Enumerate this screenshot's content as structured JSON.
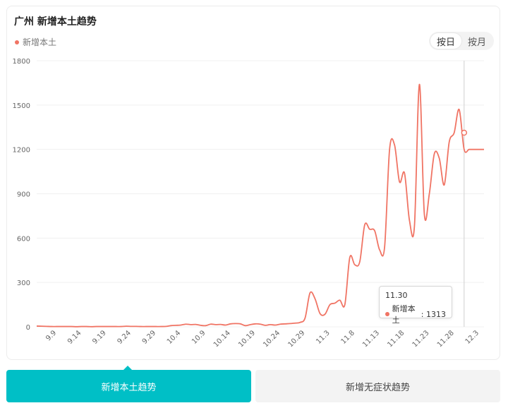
{
  "header": {
    "title": "广州 新增本土趋势"
  },
  "legend": {
    "label": "新增本土",
    "color": "#f07464"
  },
  "toggle": {
    "day_label": "按日",
    "month_label": "按月",
    "active": "day"
  },
  "tooltip": {
    "date": "11.30",
    "series_label": "新增本土",
    "value": "1313"
  },
  "tabs": [
    {
      "label": "新增本土趋势",
      "active": true
    },
    {
      "label": "新增无症状趋势",
      "active": false
    }
  ],
  "chart_data": {
    "type": "line",
    "title": "广州 新增本土趋势",
    "xlabel": "",
    "ylabel": "",
    "ylim": [
      0,
      1800
    ],
    "yticks": [
      0,
      300,
      600,
      900,
      1200,
      1500,
      1800
    ],
    "grid": true,
    "legend_position": "top-left",
    "line_color": "#f07464",
    "x_tick_labels": [
      "9.9",
      "9.14",
      "9.19",
      "9.24",
      "9.29",
      "10.4",
      "10.9",
      "10.14",
      "10.19",
      "10.24",
      "10.29",
      "11.3",
      "11.8",
      "11.13",
      "11.18",
      "11.23",
      "11.28",
      "12.3"
    ],
    "x_start": "9.5",
    "x_end": "12.4",
    "highlight": {
      "x": "11.30",
      "y": 1313
    },
    "series": [
      {
        "name": "新增本土",
        "x": [
          "9.5",
          "9.6",
          "9.7",
          "9.8",
          "9.9",
          "9.10",
          "9.11",
          "9.12",
          "9.13",
          "9.14",
          "9.15",
          "9.16",
          "9.17",
          "9.18",
          "9.19",
          "9.20",
          "9.21",
          "9.22",
          "9.23",
          "9.24",
          "9.25",
          "9.26",
          "9.27",
          "9.28",
          "9.29",
          "9.30",
          "10.1",
          "10.2",
          "10.3",
          "10.4",
          "10.5",
          "10.6",
          "10.7",
          "10.8",
          "10.9",
          "10.10",
          "10.11",
          "10.12",
          "10.13",
          "10.14",
          "10.15",
          "10.16",
          "10.17",
          "10.18",
          "10.19",
          "10.20",
          "10.21",
          "10.22",
          "10.23",
          "10.24",
          "10.25",
          "10.26",
          "10.27",
          "10.28",
          "10.29",
          "10.30",
          "10.31",
          "11.1",
          "11.2",
          "11.3",
          "11.4",
          "11.5",
          "11.6",
          "11.7",
          "11.8",
          "11.9",
          "11.10",
          "11.11",
          "11.12",
          "11.13",
          "11.14",
          "11.15",
          "11.16",
          "11.17",
          "11.18",
          "11.19",
          "11.20",
          "11.21",
          "11.22",
          "11.23",
          "11.24",
          "11.25",
          "11.26",
          "11.27",
          "11.28",
          "11.29",
          "11.30",
          "12.1",
          "12.2",
          "12.3",
          "12.4"
        ],
        "values": [
          5,
          4,
          3,
          2,
          2,
          2,
          2,
          2,
          1,
          2,
          2,
          1,
          2,
          2,
          2,
          2,
          2,
          2,
          4,
          3,
          3,
          2,
          2,
          2,
          2,
          2,
          3,
          8,
          10,
          12,
          18,
          15,
          16,
          10,
          8,
          18,
          15,
          16,
          12,
          20,
          22,
          20,
          8,
          15,
          20,
          18,
          10,
          15,
          12,
          18,
          20,
          22,
          25,
          30,
          60,
          230,
          190,
          90,
          85,
          150,
          160,
          180,
          150,
          470,
          420,
          440,
          690,
          660,
          650,
          520,
          540,
          1200,
          1230,
          980,
          1040,
          720,
          680,
          1640,
          760,
          900,
          1170,
          1140,
          960,
          1250,
          1313,
          1470,
          1200,
          1200,
          1200,
          1200,
          1200
        ]
      }
    ]
  }
}
